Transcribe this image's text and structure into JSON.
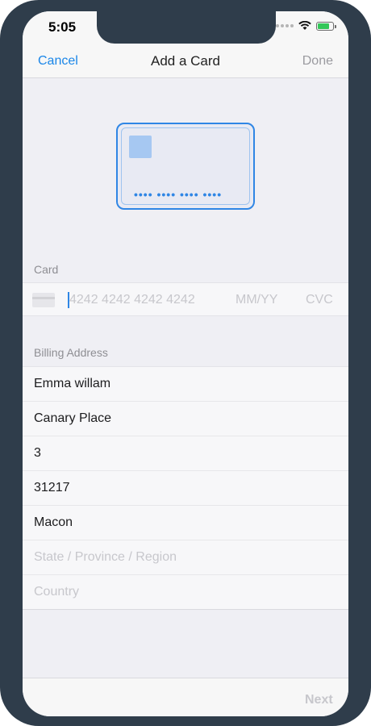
{
  "status_bar": {
    "time": "5:05"
  },
  "nav": {
    "cancel": "Cancel",
    "title": "Add a Card",
    "done": "Done"
  },
  "card_preview": {
    "number_mask": "•••• •••• •••• ••••"
  },
  "card_section": {
    "label": "Card",
    "number_placeholder": "4242 4242 4242 4242",
    "expiry_placeholder": "MM/YY",
    "cvc_placeholder": "CVC"
  },
  "billing": {
    "label": "Billing Address",
    "fields": [
      {
        "value": "Emma willam",
        "placeholder": false
      },
      {
        "value": "Canary Place",
        "placeholder": false
      },
      {
        "value": "3",
        "placeholder": false
      },
      {
        "value": "31217",
        "placeholder": false
      },
      {
        "value": "Macon",
        "placeholder": false
      },
      {
        "value": "State / Province / Region",
        "placeholder": true
      },
      {
        "value": "Country",
        "placeholder": true
      }
    ]
  },
  "bottom": {
    "next": "Next"
  },
  "colors": {
    "accent": "#1a86e8",
    "frame": "#2f3d4b",
    "background": "#efeff4"
  }
}
